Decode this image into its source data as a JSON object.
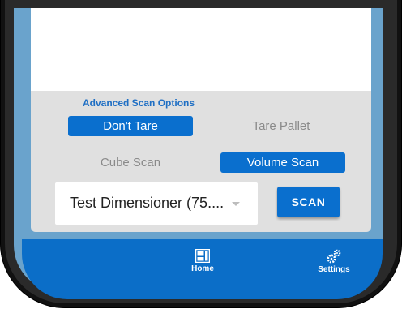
{
  "scan_options": {
    "title": "Advanced Scan Options",
    "dont_tare": "Don't Tare",
    "tare_pallet": "Tare Pallet",
    "cube_scan": "Cube Scan",
    "volume_scan": "Volume Scan"
  },
  "dimensioner": {
    "selected": "Test Dimensioner (75....",
    "scan_label": "SCAN"
  },
  "bottom_nav": {
    "home_label": "Home",
    "home_icon": "home-dashboard-icon",
    "settings_label": "Settings",
    "settings_icon": "gears-icon"
  },
  "colors": {
    "accent": "#0a6fce",
    "nav_background": "#0b6ec8",
    "panel_background": "#e0e0e0",
    "frame_side": "#6aa3cc"
  }
}
